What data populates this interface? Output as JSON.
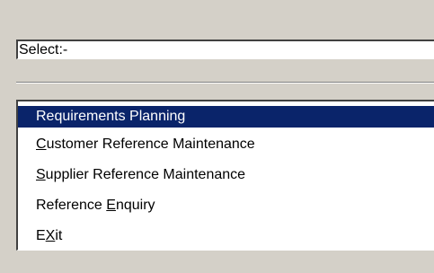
{
  "select": {
    "label": "Select:-"
  },
  "menu": {
    "items": [
      {
        "pre": "",
        "key": "",
        "post": "Requirements Planning",
        "selected": true
      },
      {
        "pre": "",
        "key": "C",
        "post": "ustomer Reference Maintenance",
        "selected": false
      },
      {
        "pre": "",
        "key": "S",
        "post": "upplier Reference Maintenance",
        "selected": false
      },
      {
        "pre": "Reference ",
        "key": "E",
        "post": "nquiry",
        "selected": false
      },
      {
        "pre": "E",
        "key": "X",
        "post": "it",
        "selected": false
      }
    ]
  },
  "colors": {
    "background": "#d4d0c8",
    "highlight": "#0a246a",
    "highlight_text": "#ffffff"
  }
}
